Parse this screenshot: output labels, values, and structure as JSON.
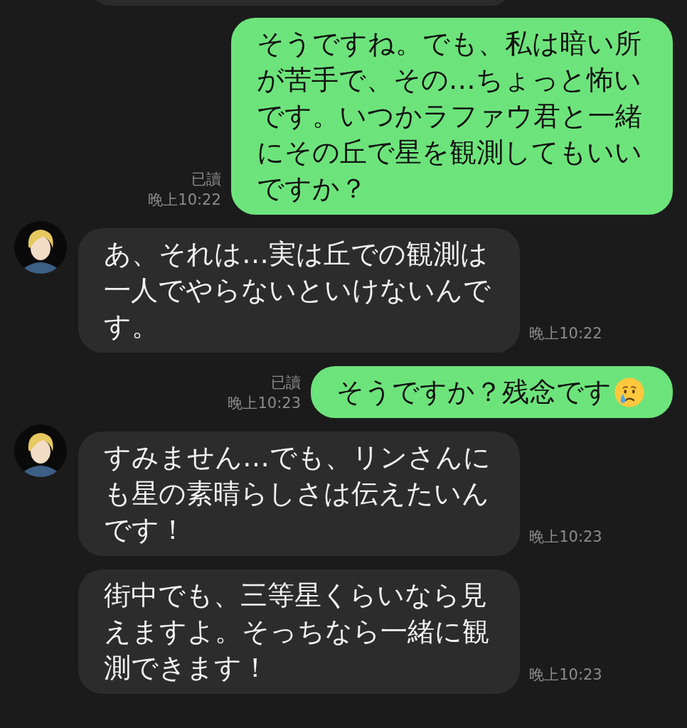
{
  "messages": [
    {
      "kind": "sent",
      "text": "そうですね。でも、私は暗い所が苦手で、その…ちょっと怖いです。いつかラファウ君と一緒にその丘で星を観測してもいいですか？",
      "read_label": "已讀",
      "time": "晚上10:22",
      "trailing_emoji": false
    },
    {
      "kind": "received",
      "text": "あ、それは…実は丘での観測は一人でやらないといけないんです。",
      "time": "晚上10:22",
      "avatar": true
    },
    {
      "kind": "sent",
      "text": "そうですか？残念です",
      "read_label": "已讀",
      "time": "晚上10:23",
      "trailing_emoji": true
    },
    {
      "kind": "received",
      "text": "すみません…でも、リンさんにも星の素晴らしさは伝えたいんです！",
      "time": "晚上10:23",
      "avatar": true
    },
    {
      "kind": "received",
      "text": "街中でも、三等星くらいなら見えますよ。そっちなら一緒に観測できます！",
      "time": "晚上10:23",
      "avatar": false
    }
  ]
}
